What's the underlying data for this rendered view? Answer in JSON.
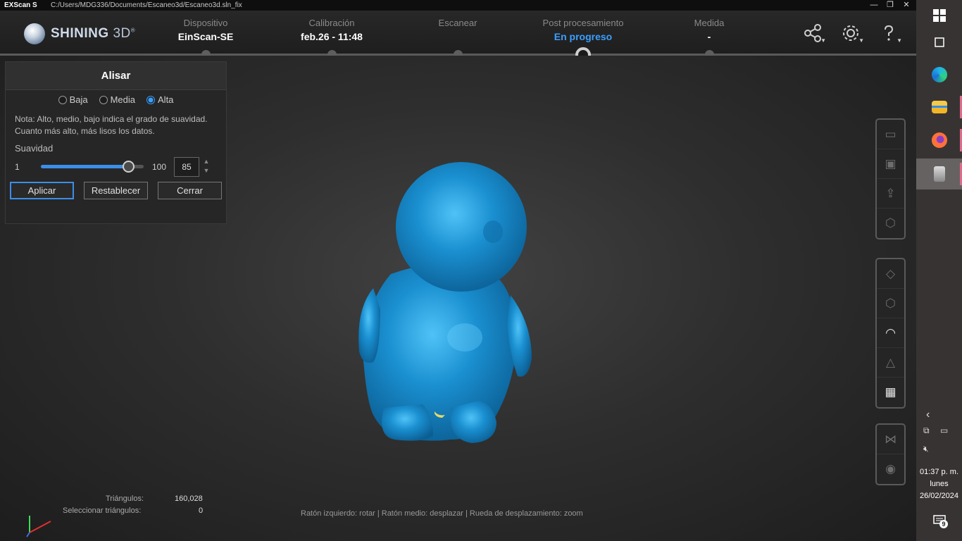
{
  "window": {
    "app_name": "EXScan S",
    "path": "C:/Users/MDG336/Documents/Escaneo3d/Escaneo3d.sln_fix",
    "minimize": "—",
    "maximize": "❐",
    "close": "✕"
  },
  "logo": {
    "text_bold": "SHINING",
    "text_rest": " 3D",
    "reg": "®"
  },
  "steps": [
    {
      "label": "Dispositivo",
      "value": "EinScan-SE"
    },
    {
      "label": "Calibración",
      "value": "feb.26 - 11:48"
    },
    {
      "label": "Escanear",
      "value": ""
    },
    {
      "label": "Post procesamiento",
      "value": "En progreso"
    },
    {
      "label": "Medida",
      "value": "-"
    }
  ],
  "header_icons": [
    "share-icon",
    "settings-icon",
    "help-icon"
  ],
  "panel": {
    "title": "Alisar",
    "options": [
      "Baja",
      "Media",
      "Alta"
    ],
    "selected": "Alta",
    "note": "Nota: Alto, medio, bajo indica el grado de suavidad. Cuanto más alto, más lisos los datos.",
    "smooth_label": "Suavidad",
    "min": "1",
    "max": "100",
    "value": "85",
    "slider_fraction": 0.85,
    "buttons": {
      "apply": "Aplicar",
      "reset": "Restablecer",
      "close": "Cerrar"
    }
  },
  "stats": {
    "triangles_label": "Triángulos:",
    "triangles_value": "160,028",
    "selected_label": "Seleccionar triángulos:",
    "selected_value": "0"
  },
  "hint": "Ratón izquierdo: rotar | Ratón medio: desplazar | Rueda de desplazamiento: zoom",
  "toolbar_groups": [
    [
      "open-folder-icon",
      "save-icon",
      "export-icon",
      "model-cube-icon"
    ],
    [
      "view-top-icon",
      "view-iso-icon",
      "smooth-surface-icon",
      "triangle-mesh-icon",
      "wireframe-box-icon"
    ],
    [
      "mirror-icon",
      "visibility-eye-icon"
    ]
  ],
  "model_color": "#1a8fd0",
  "accent_color": "#3b9fff",
  "taskbar": {
    "time": "01:37 p. m.",
    "day": "lunes",
    "date": "26/02/2024",
    "notifications": "9"
  }
}
